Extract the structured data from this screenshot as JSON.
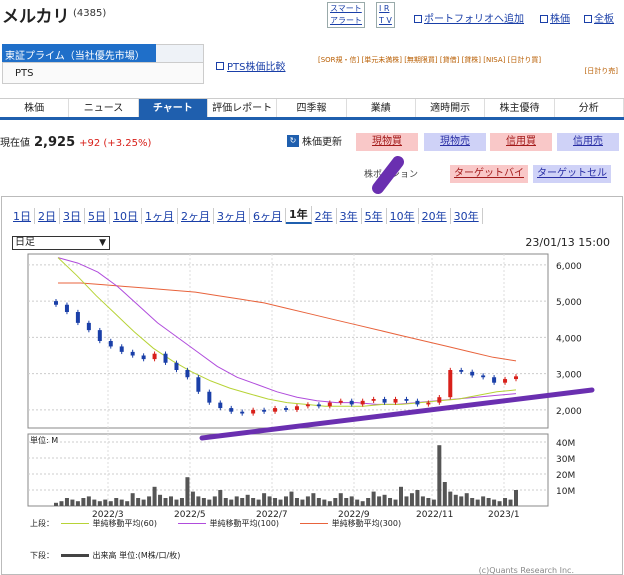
{
  "header": {
    "title": "メルカリ",
    "code": "(4385)",
    "smart_alert": [
      "スマート",
      "アラート"
    ],
    "irtv": [
      "I R",
      "T V"
    ],
    "portfolio_link": "ポートフォリオへ追加",
    "stock_link": "株価",
    "board_link": "全板"
  },
  "market": {
    "selected": "東証プライム（当社優先市場）",
    "option": "PTS",
    "pts_compare": "PTS株価比較",
    "tags": "[SOR規・信] [単元未満株] [無期限買] [貸借] [貸株] [NISA] [日計り買]",
    "tags2": "[日計り売]"
  },
  "tabs": [
    "株価",
    "ニュース",
    "チャート",
    "評価レポート",
    "四季報",
    "業績",
    "適時開示",
    "株主優待",
    "分析"
  ],
  "active_tab": "チャート",
  "price": {
    "label": "現在値",
    "value": "2,925",
    "change": "+92 (+3.25%)",
    "refresh": "株価更新",
    "buttons": [
      "現物買",
      "現物売",
      "信用買",
      "信用売"
    ],
    "position_label": "株ポジション",
    "target_buy": "ターゲットバイ",
    "target_sell": "ターゲットセル"
  },
  "ranges": [
    "1日",
    "2日",
    "3日",
    "5日",
    "10日",
    "1ヶ月",
    "2ヶ月",
    "3ヶ月",
    "6ヶ月",
    "1年",
    "2年",
    "3年",
    "5年",
    "10年",
    "20年",
    "30年"
  ],
  "active_range": "1年",
  "chart_controls": {
    "period_select": "日足",
    "timestamp": "23/01/13 15:00"
  },
  "legend": {
    "upper_label": "上段：",
    "lower_label": "下段：",
    "ma60": "単純移動平均(60)",
    "ma100": "単純移動平均(100)",
    "ma300": "単純移動平均(300)",
    "volume": "出来高 単位:(M株/口/枚)",
    "unit": "単位: M",
    "credit": "(c)Quants Research Inc."
  },
  "colors": {
    "ma60": "#b7d336",
    "ma100": "#b04cdc",
    "ma300": "#e8633c",
    "trend": "#6a2fb0",
    "up": "#d8201a",
    "down": "#1a3fa8"
  },
  "chart_data": {
    "type": "line",
    "x_ticks": [
      "2022/3",
      "2022/5",
      "2022/7",
      "2022/9",
      "2022/11",
      "2023/1"
    ],
    "price_ticks": [
      "6,000",
      "5,000",
      "4,000",
      "3,000",
      "2,000"
    ],
    "volume_ticks": [
      "40M",
      "30M",
      "20M",
      "10M"
    ],
    "ylim": [
      1500,
      6300
    ],
    "volume_ylim": [
      0,
      45
    ],
    "close": [
      4900,
      4700,
      4400,
      4200,
      3900,
      3750,
      3600,
      3500,
      3400,
      3550,
      3300,
      3100,
      2900,
      2500,
      2200,
      2050,
      1950,
      1900,
      2000,
      1950,
      2050,
      2000,
      2100,
      2150,
      2100,
      2200,
      2250,
      2150,
      2250,
      2300,
      2200,
      2300,
      2250,
      2150,
      2200,
      2350,
      3100,
      3050,
      2950,
      2900,
      2750,
      2850,
      2925
    ],
    "ma60": [
      6200,
      5700,
      5150,
      4650,
      4150,
      3700,
      3350,
      3050,
      2800,
      2600,
      2450,
      2300,
      2200,
      2150,
      2100,
      2100,
      2100,
      2150,
      2150,
      2200,
      2250,
      2300,
      2400,
      2500,
      2550
    ],
    "ma100": [
      6200,
      6050,
      5800,
      5400,
      4900,
      4400,
      4000,
      3600,
      3200,
      2900,
      2700,
      2500,
      2350,
      2250,
      2200,
      2200,
      2150,
      2150,
      2200,
      2250,
      2300,
      2350,
      2400,
      2450
    ],
    "ma300": [
      5500,
      5500,
      5450,
      5400,
      5350,
      5300,
      5250,
      5150,
      5050,
      4950,
      4800,
      4650,
      4500,
      4350,
      4200,
      4050,
      3900,
      3750,
      3600,
      3450,
      3350
    ],
    "volume": [
      2,
      3,
      5,
      4,
      3,
      5,
      6,
      4,
      3,
      4,
      3,
      5,
      4,
      3,
      8,
      5,
      4,
      6,
      12,
      7,
      5,
      6,
      4,
      5,
      18,
      9,
      6,
      5,
      4,
      6,
      10,
      5,
      4,
      6,
      5,
      7,
      5,
      4,
      8,
      6,
      5,
      4,
      6,
      9,
      5,
      4,
      6,
      8,
      5,
      4,
      3,
      5,
      8,
      5,
      6,
      4,
      3,
      5,
      9,
      6,
      7,
      5,
      4,
      12,
      6,
      8,
      10,
      6,
      5,
      4,
      38,
      15,
      9,
      7,
      6,
      8,
      5,
      4,
      6,
      5,
      4,
      3,
      5,
      4,
      10
    ]
  }
}
